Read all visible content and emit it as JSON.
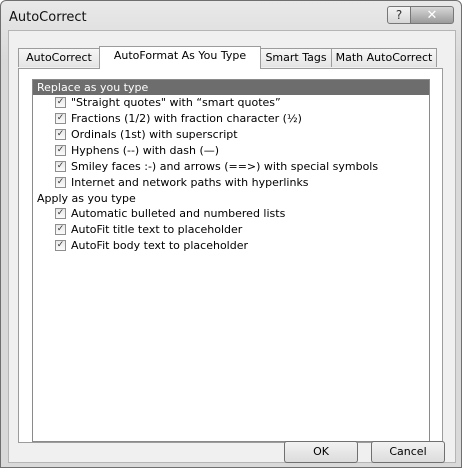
{
  "window": {
    "title": "AutoCorrect"
  },
  "titlebar": {
    "help_glyph": "?",
    "close_glyph": "✕"
  },
  "tabs": [
    {
      "label": "AutoCorrect"
    },
    {
      "label": "AutoFormat As You Type"
    },
    {
      "label": "Smart Tags"
    },
    {
      "label": "Math AutoCorrect"
    }
  ],
  "active_tab": "AutoFormat As You Type",
  "groups": {
    "replace": {
      "heading": "Replace as you type",
      "items": [
        {
          "label": "\"Straight quotes\" with “smart quotes”",
          "checked": true
        },
        {
          "label": "Fractions (1/2) with fraction character (½)",
          "checked": true
        },
        {
          "label": "Ordinals (1st) with superscript",
          "checked": true
        },
        {
          "label": "Hyphens (--) with dash (—)",
          "checked": true
        },
        {
          "label": "Smiley faces :-) and arrows (==>) with special symbols",
          "checked": true
        },
        {
          "label": "Internet and network paths with hyperlinks",
          "checked": true
        }
      ]
    },
    "apply": {
      "heading": "Apply as you type",
      "items": [
        {
          "label": "Automatic bulleted and numbered lists",
          "checked": true
        },
        {
          "label": "AutoFit title text to placeholder",
          "checked": true
        },
        {
          "label": "AutoFit body text to placeholder",
          "checked": true
        }
      ]
    }
  },
  "buttons": {
    "ok": "OK",
    "cancel": "Cancel"
  },
  "check_glyph": "✓",
  "colors": {
    "selected_heading_bg": "#6d6d6d"
  }
}
